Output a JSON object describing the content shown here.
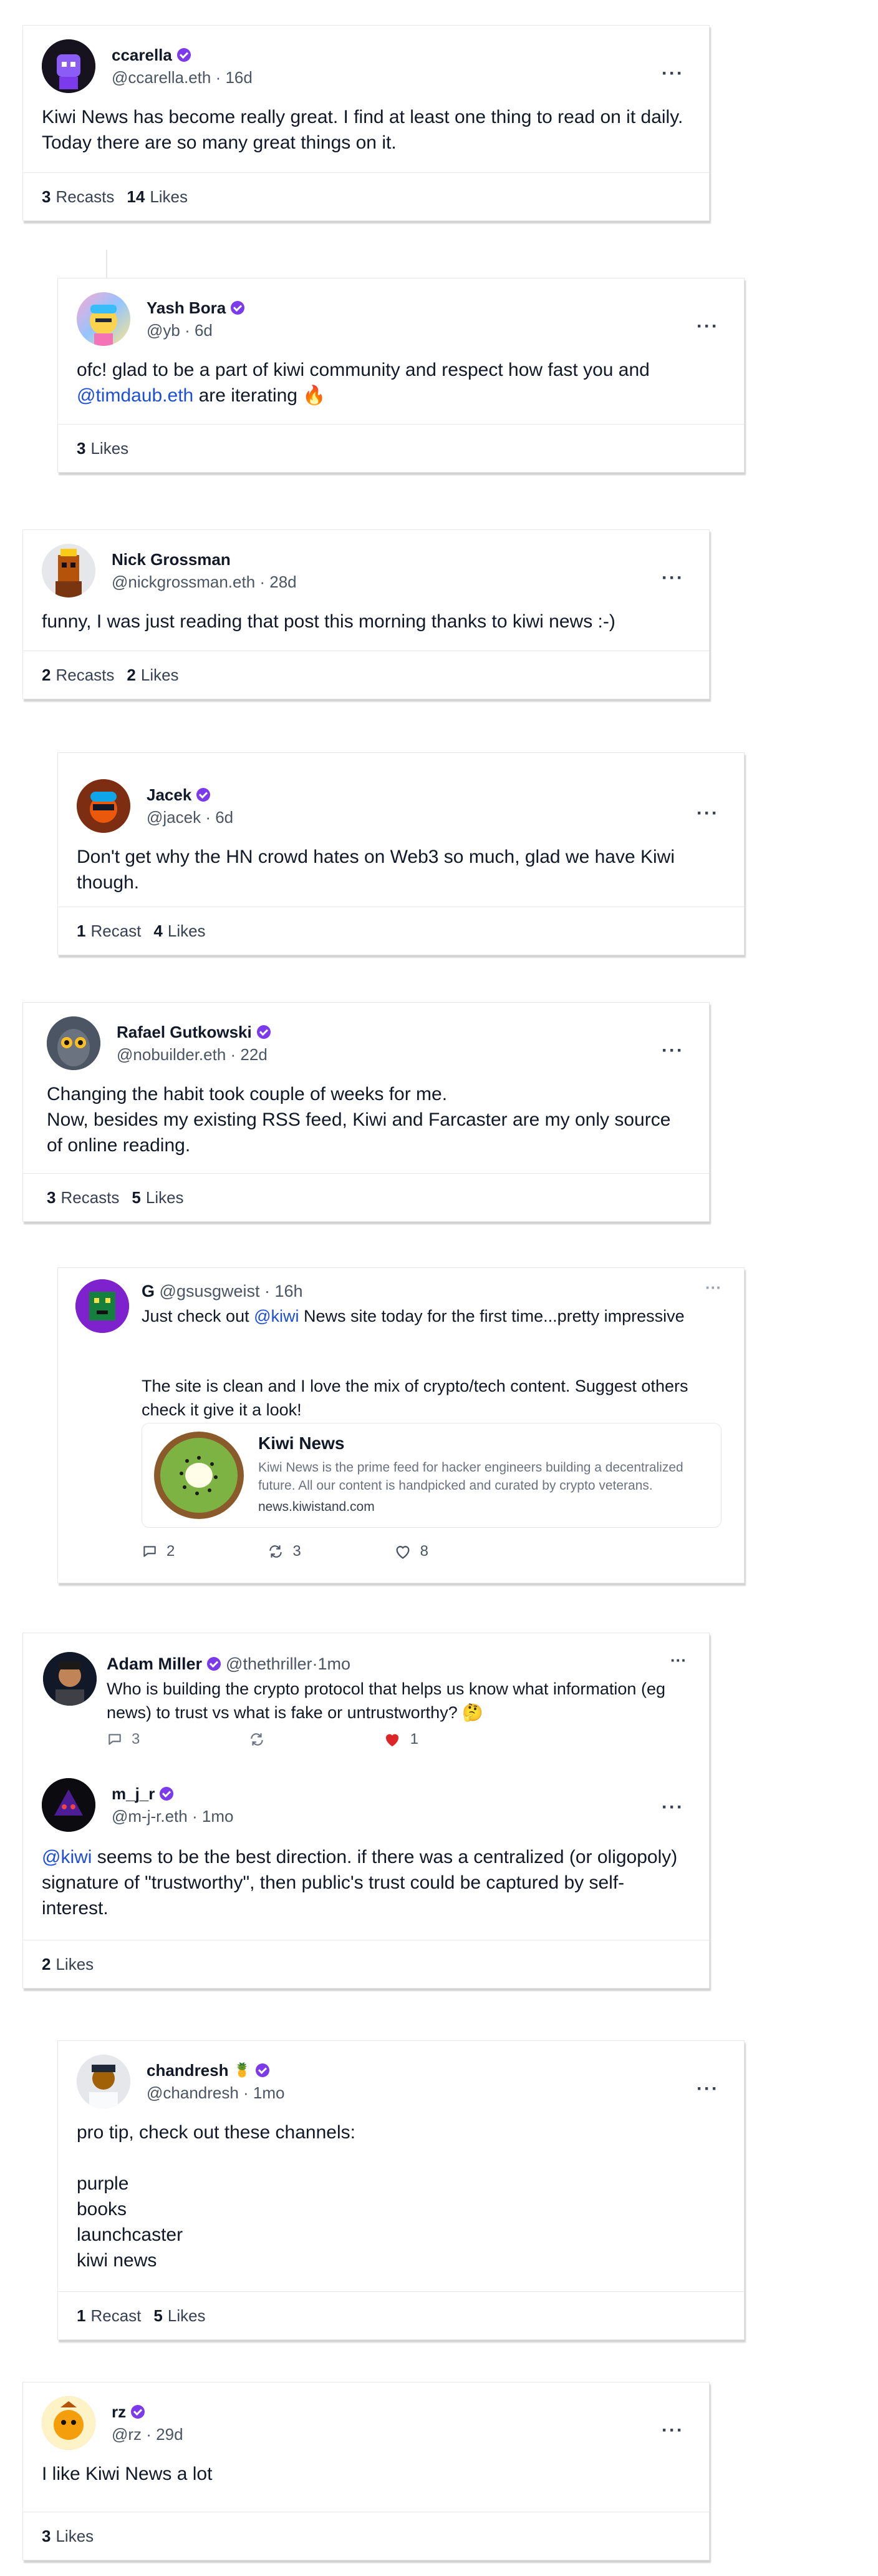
{
  "cards": [
    {
      "name": "ccarella",
      "handle": "@ccarella.eth",
      "age": "16d",
      "text": "Kiwi News has become really great. I find at least one thing to read on it daily. Today there are so many great things on it.",
      "recasts": "3",
      "recasts_label": "Recasts",
      "likes": "14",
      "likes_label": "Likes"
    },
    {
      "name": "Yash Bora",
      "handle": "@yb",
      "age": "6d",
      "text_before": "ofc! glad to be a part of kiwi community and respect how fast you and ",
      "mention": "@timdaub.eth",
      "text_after": " are iterating 🔥",
      "likes": "3",
      "likes_label": "Likes"
    },
    {
      "name": "Nick Grossman",
      "handle": "@nickgrossman.eth",
      "age": "28d",
      "text": "funny, I was just reading that post this morning thanks to kiwi news :-)",
      "recasts": "2",
      "recasts_label": "Recasts",
      "likes": "2",
      "likes_label": "Likes"
    },
    {
      "name": "Jacek",
      "handle": "@jacek",
      "age": "6d",
      "text": "Don't get why the HN crowd hates on Web3 so much, glad we have Kiwi though.",
      "recasts": "1",
      "recasts_label": "Recast",
      "likes": "4",
      "likes_label": "Likes"
    },
    {
      "name": "Rafael Gutkowski",
      "handle": "@nobuilder.eth",
      "age": "22d",
      "text": "Changing the habit took couple of weeks for me.\nNow, besides my existing RSS feed, Kiwi and Farcaster are my only source of online reading.",
      "recasts": "3",
      "recasts_label": "Recasts",
      "likes": "5",
      "likes_label": "Likes"
    },
    {
      "name": "G",
      "handle": "@gsusgweist",
      "age": "16h",
      "text_before": "Just check out ",
      "mention": "@kiwi",
      "text_after": " News site today for the first time...pretty impressive",
      "text2": "The site is clean and I love the mix of crypto/tech content. Suggest others check it give it a look!",
      "link_title": "Kiwi News",
      "link_desc": "Kiwi News is the prime feed for hacker engineers building a decentralized future. All our content is handpicked and curated by crypto veterans.",
      "link_url": "news.kiwistand.com",
      "replies": "2",
      "recasts": "3",
      "likes": "8"
    },
    {
      "parent_name": "Adam Miller",
      "parent_handle": "@thethriller",
      "parent_age": "1mo",
      "parent_text": "Who is building the crypto protocol that helps us know what information (eg news) to trust vs what is fake or untrustworthy? 🤔",
      "parent_replies": "3",
      "parent_likes": "1",
      "name": "m_j_r",
      "handle": "@m-j-r.eth",
      "age": "1mo",
      "mention": "@kiwi",
      "text_after": " seems to be the best direction. if there was a centralized (or oligopoly) signature of \"trustworthy\", then public's trust could be captured by self-interest.",
      "likes": "2",
      "likes_label": "Likes"
    },
    {
      "name": "chandresh",
      "handle": "@chandresh",
      "age": "1mo",
      "text": "pro tip, check out these channels:\n\npurple\nbooks\nlaunchcaster\nkiwi news",
      "recasts": "1",
      "recasts_label": "Recast",
      "likes": "5",
      "likes_label": "Likes"
    },
    {
      "name": "rz",
      "handle": "@rz",
      "age": "29d",
      "text": "I like Kiwi News a lot",
      "likes": "3",
      "likes_label": "Likes"
    }
  ],
  "sep": " · ",
  "more": "···",
  "colors": {
    "accent": "#7c3aed",
    "link": "#1d4ed8",
    "heart": "#dc2626"
  }
}
